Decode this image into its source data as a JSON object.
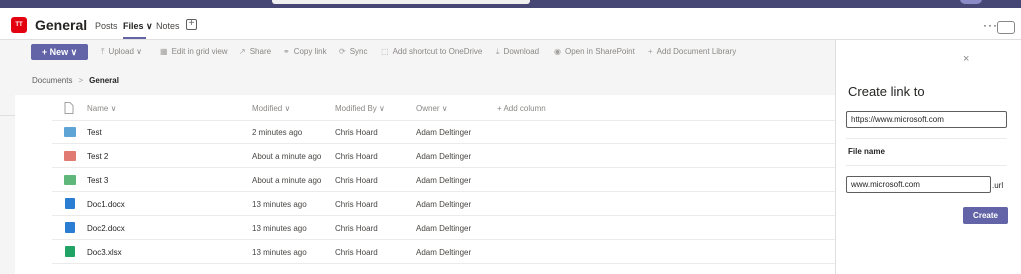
{
  "header": {
    "team_initials": "TT",
    "channel_title": "General",
    "tabs": [
      {
        "label": "Posts"
      },
      {
        "label": "Files ∨"
      },
      {
        "label": "Notes"
      }
    ],
    "add_tab": "+",
    "more": "···"
  },
  "commandbar": {
    "new_label": "+ New ∨",
    "items": [
      {
        "icon": "⤒",
        "label": "Upload ∨"
      },
      {
        "icon": "▦",
        "label": "Edit in grid view"
      },
      {
        "icon": "↗",
        "label": "Share"
      },
      {
        "icon": "⚭",
        "label": "Copy link"
      },
      {
        "icon": "⟳",
        "label": "Sync"
      },
      {
        "icon": "⬚",
        "label": "Add shortcut to OneDrive"
      },
      {
        "icon": "⤓",
        "label": "Download"
      },
      {
        "icon": "◉",
        "label": "Open in SharePoint"
      },
      {
        "icon": "+",
        "label": "Add Document Library"
      }
    ]
  },
  "breadcrumb": {
    "root": "Documents",
    "sep": ">",
    "current": "General"
  },
  "table": {
    "columns": {
      "name": "Name ∨",
      "modified": "Modified ∨",
      "modified_by": "Modified By ∨",
      "owner": "Owner ∨",
      "add_column": "+ Add column"
    },
    "rows": [
      {
        "name": "Test",
        "modified": "2 minutes ago",
        "modified_by": "Chris Hoard",
        "owner": "Adam Deltinger",
        "icon": "folder-icon",
        "color": "#5ea5d6"
      },
      {
        "name": "Test 2",
        "modified": "About a minute ago",
        "modified_by": "Chris Hoard",
        "owner": "Adam Deltinger",
        "icon": "folder-icon",
        "color": "#e07a72"
      },
      {
        "name": "Test 3",
        "modified": "About a minute ago",
        "modified_by": "Chris Hoard",
        "owner": "Adam Deltinger",
        "icon": "folder-icon",
        "color": "#5fb87a"
      },
      {
        "name": "Doc1.docx",
        "modified": "13 minutes ago",
        "modified_by": "Chris Hoard",
        "owner": "Adam Deltinger",
        "icon": "word-doc-icon",
        "color": "#2b7cd3"
      },
      {
        "name": "Doc2.docx",
        "modified": "13 minutes ago",
        "modified_by": "Chris Hoard",
        "owner": "Adam Deltinger",
        "icon": "word-doc-icon",
        "color": "#2b7cd3"
      },
      {
        "name": "Doc3.xlsx",
        "modified": "13 minutes ago",
        "modified_by": "Chris Hoard",
        "owner": "Adam Deltinger",
        "icon": "excel-doc-icon",
        "color": "#21a366"
      }
    ]
  },
  "panel": {
    "close": "×",
    "title": "Create link to",
    "url_value": "https://www.microsoft.com",
    "file_name_label": "File name",
    "file_name_value": "www.microsoft.com",
    "extension": ".url",
    "create_label": "Create"
  },
  "colors": {
    "accent": "#6264a7",
    "top_bar": "#464775",
    "team_badge": "#e3000f"
  }
}
